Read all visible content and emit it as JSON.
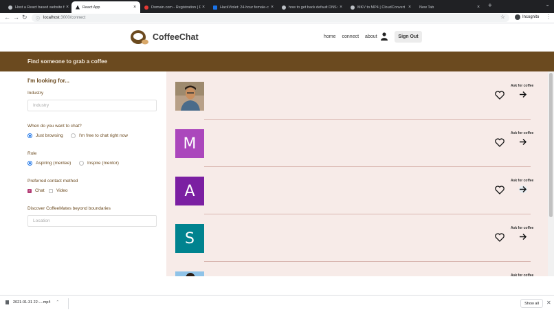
{
  "browser": {
    "tabs": [
      {
        "title": "Host a React based website fr",
        "favicon_color": "#bdc1c6",
        "active": false
      },
      {
        "title": "React App",
        "favicon_color": "#202124",
        "active": true
      },
      {
        "title": "Domain.com - Registration | D",
        "favicon_color": "#e53935",
        "active": false
      },
      {
        "title": "HackViolet: 24-hour female-c",
        "favicon_color": "#1a73e8",
        "active": false
      },
      {
        "title": "how to get back default DNS s",
        "favicon_color": "#bdc1c6",
        "active": false
      },
      {
        "title": "MKV to MP4 | CloudConvert",
        "favicon_color": "#bdc1c6",
        "active": false
      },
      {
        "title": "New Tab",
        "favicon_color": "",
        "active": false
      }
    ],
    "url_host": "localhost",
    "url_path": ":3000/connect",
    "profile_label": "Incognito"
  },
  "site": {
    "brand": "CoffeeChat",
    "nav": [
      "home",
      "connect",
      "about"
    ],
    "signout_label": "Sign Out",
    "banner": "Find someone to grab a coffee"
  },
  "filters": {
    "title": "I'm looking for...",
    "industry_label": "Industry",
    "industry_placeholder": "Industry",
    "when_label": "When do you want to chat?",
    "when_options": [
      "Just browsing",
      "I'm free to chat right now"
    ],
    "role_label": "Role",
    "role_options": [
      "Aspiring (mentee)",
      "Inspire (mentor)"
    ],
    "contact_label": "Preferred contact method",
    "contact_options": [
      "Chat",
      "Video"
    ],
    "discover_label": "Discover CoffeeMates beyond boundaries",
    "location_placeholder": "Location"
  },
  "results": {
    "ask_label": "Ask for coffee",
    "people": [
      {
        "initial": "",
        "color": "#c7a98a",
        "has_photo": true
      },
      {
        "initial": "M",
        "color": "#ab47bc"
      },
      {
        "initial": "A",
        "color": "#7b1fa2"
      },
      {
        "initial": "S",
        "color": "#00838f"
      },
      {
        "initial": "",
        "color": "#64b5f6",
        "has_photo": true
      }
    ]
  },
  "downloads": {
    "file": "2021-01-31 22-....mp4",
    "show_all": "Show all"
  }
}
